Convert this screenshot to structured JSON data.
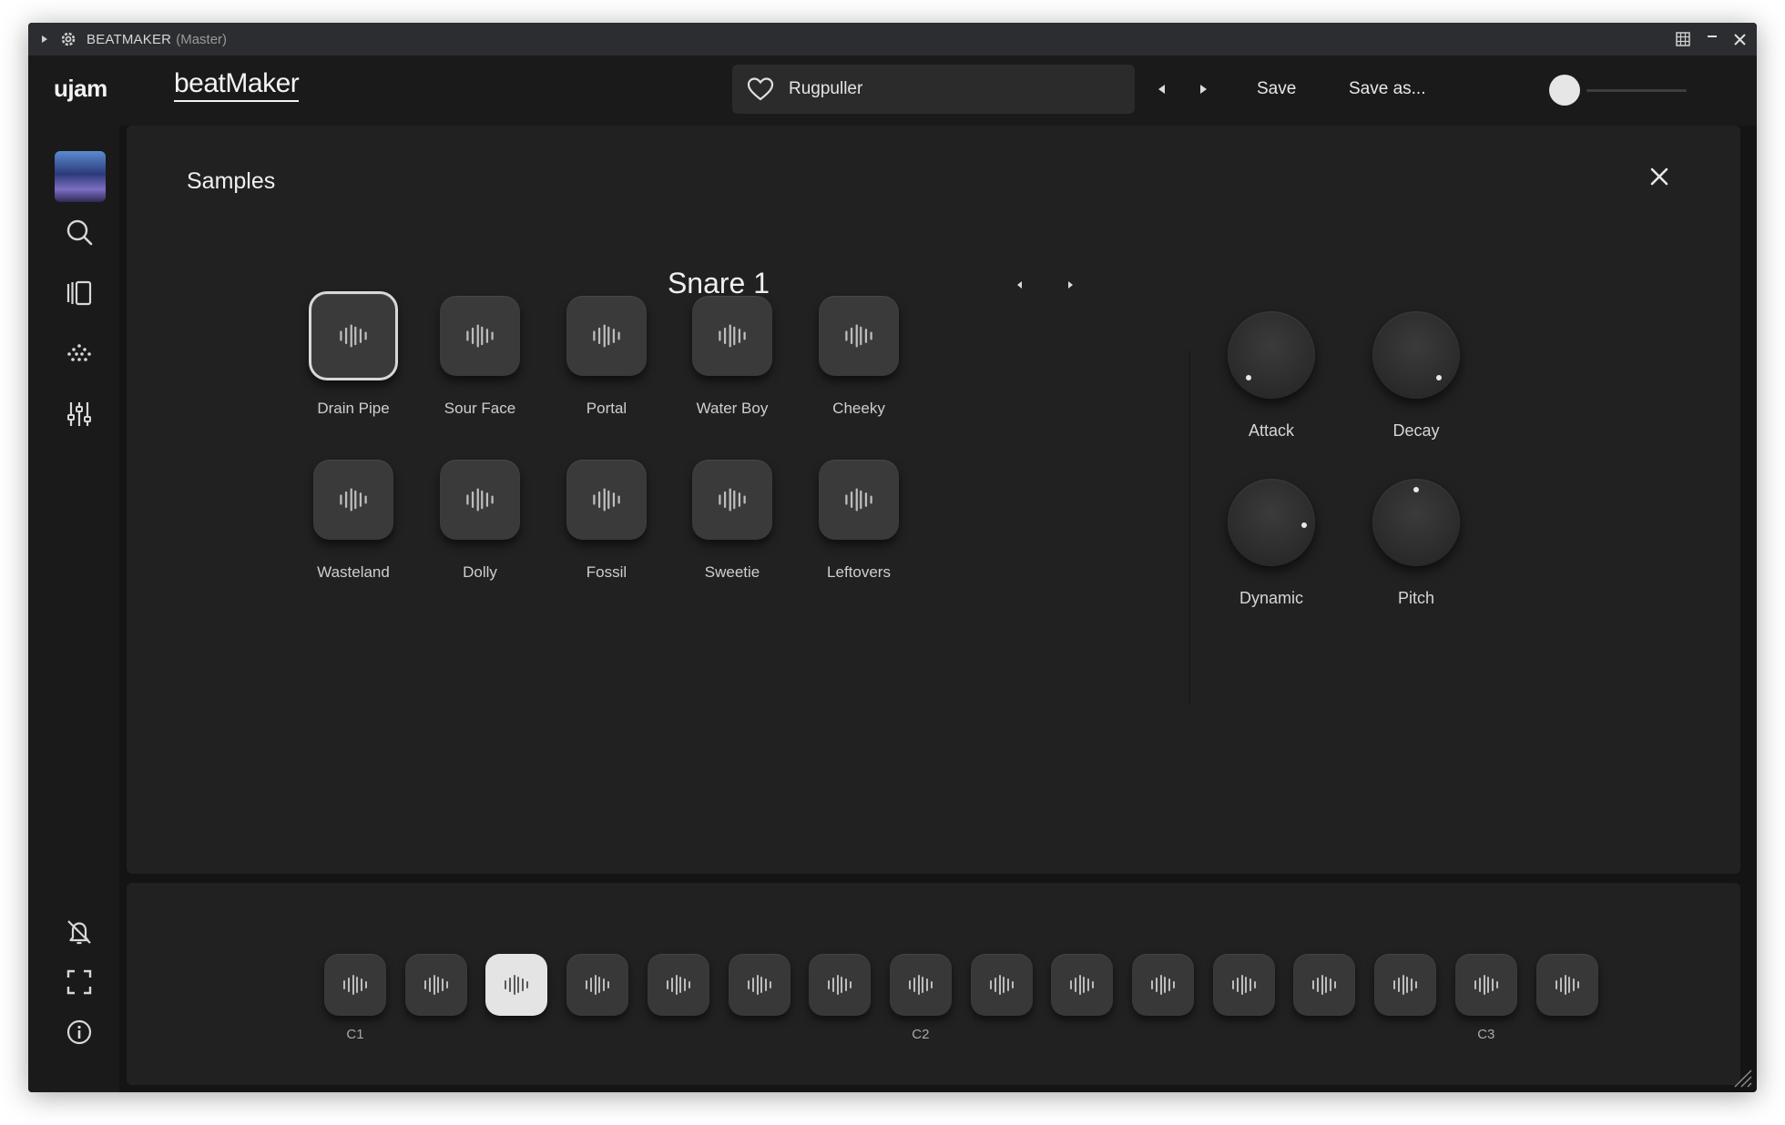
{
  "window": {
    "title": "BEATMAKER",
    "subtitle": "(Master)"
  },
  "header": {
    "brand": "ujam",
    "product": "beatMaker",
    "preset_name": "Rugpuller",
    "save_label": "Save",
    "save_as_label": "Save as..."
  },
  "panel": {
    "title": "Samples",
    "instrument_name": "Snare 1",
    "samples": [
      {
        "label": "Drain Pipe",
        "selected": true
      },
      {
        "label": "Sour Face",
        "selected": false
      },
      {
        "label": "Portal",
        "selected": false
      },
      {
        "label": "Water Boy",
        "selected": false
      },
      {
        "label": "Cheeky",
        "selected": false
      },
      {
        "label": "Wasteland",
        "selected": false
      },
      {
        "label": "Dolly",
        "selected": false
      },
      {
        "label": "Fossil",
        "selected": false
      },
      {
        "label": "Sweetie",
        "selected": false
      },
      {
        "label": "Leftovers",
        "selected": false
      }
    ],
    "knobs": [
      {
        "label": "Attack",
        "value": 0.0
      },
      {
        "label": "Decay",
        "value": 1.0
      },
      {
        "label": "Dynamic",
        "value": 0.85
      },
      {
        "label": "Pitch",
        "value": 0.5
      }
    ]
  },
  "keyboard": {
    "pad_count": 16,
    "active_pad_index": 2,
    "note_labels": [
      {
        "pad": 0,
        "label": "C1"
      },
      {
        "pad": 7,
        "label": "C2"
      },
      {
        "pad": 14,
        "label": "C3"
      }
    ]
  },
  "colors": {
    "background": "#141414",
    "panel": "#212121",
    "pad": "#3a3a3a",
    "active_pad": "#e4e4e4",
    "text": "#d8d8d8"
  }
}
